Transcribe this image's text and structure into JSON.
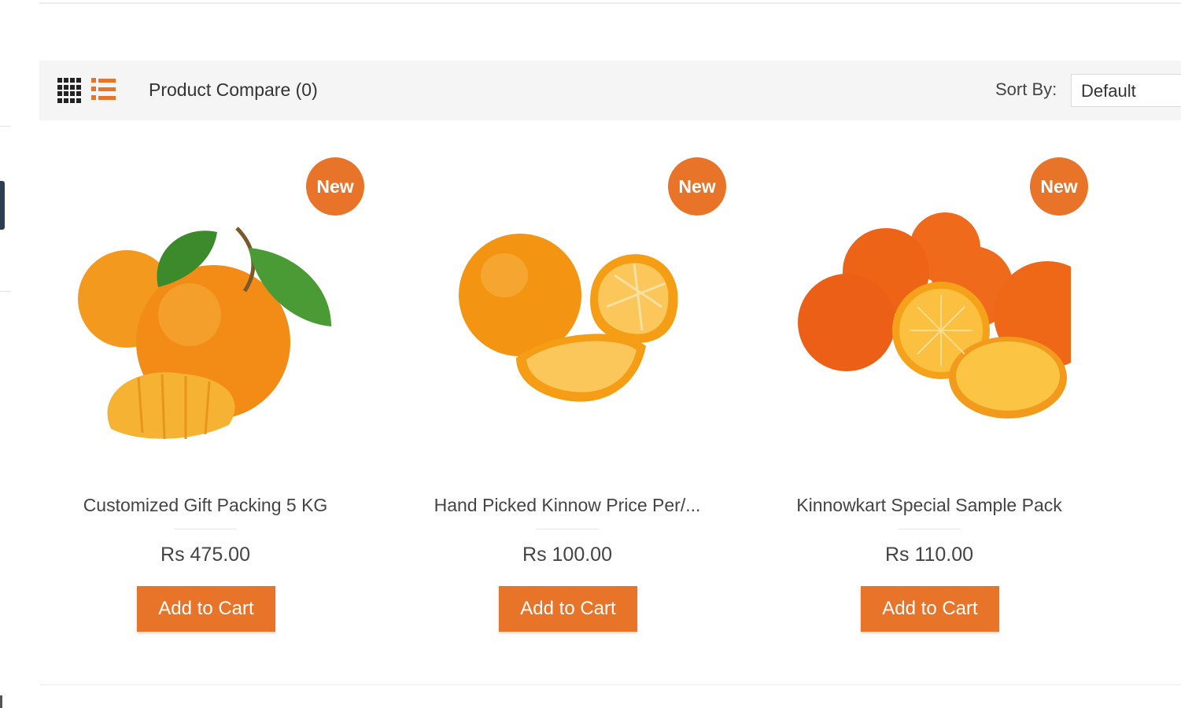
{
  "toolbar": {
    "compare_label": "Product Compare (0)",
    "sort_label": "Sort By:",
    "sort_selected": "Default"
  },
  "accent_color": "#e8742a",
  "products": [
    {
      "badge": "New",
      "name": "Customized Gift Packing 5 KG",
      "price": "Rs 475.00",
      "cart_label": "Add to Cart",
      "image": "orange-icon"
    },
    {
      "badge": "New",
      "name": "Hand Picked Kinnow Price Per/...",
      "price": "Rs 100.00",
      "cart_label": "Add to Cart",
      "image": "orange-slices-icon"
    },
    {
      "badge": "New",
      "name": "Kinnowkart Special Sample Pack",
      "price": "Rs 110.00",
      "cart_label": "Add to Cart",
      "image": "orange-pile-icon"
    }
  ]
}
